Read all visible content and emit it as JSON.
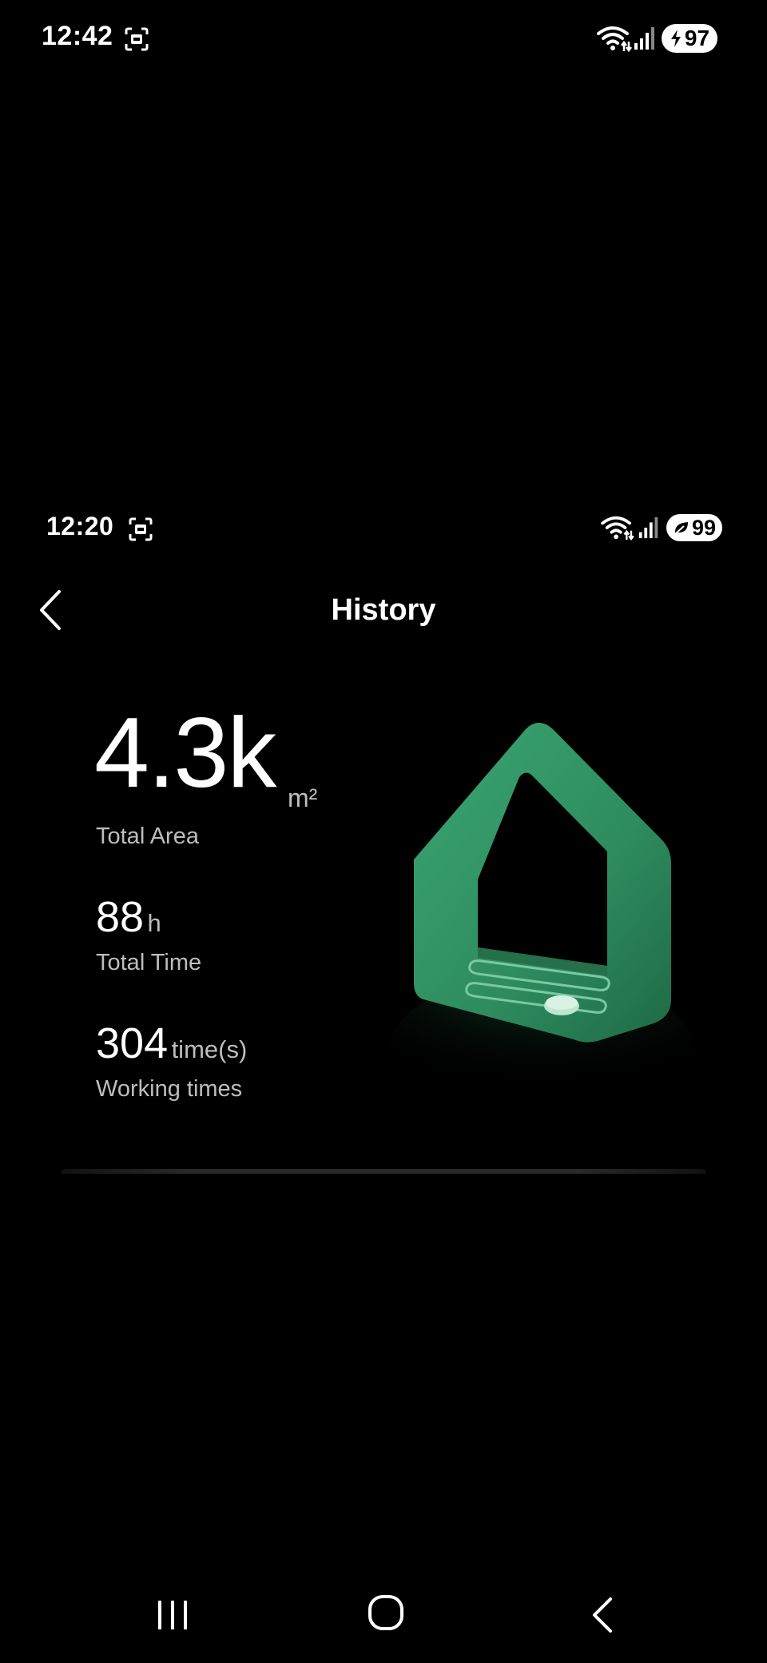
{
  "status_bar_top": {
    "time": "12:42",
    "battery": "97",
    "icons": [
      "screenshot-icon",
      "wifi-icon",
      "signal-icon",
      "charging-bolt-icon"
    ]
  },
  "status_bar_app": {
    "time": "12:20",
    "battery": "99",
    "icons": [
      "screenshot-icon",
      "wifi-icon",
      "signal-icon",
      "battery-saver-leaf-icon"
    ]
  },
  "header": {
    "title": "History",
    "back_icon": "chevron-left-icon"
  },
  "stats": {
    "total_area": {
      "value": "4.3k",
      "unit": "m²",
      "label": "Total Area"
    },
    "total_time": {
      "value": "88",
      "unit": "h",
      "label": "Total Time"
    },
    "working_times": {
      "value": "304",
      "unit": "time(s)",
      "label": "Working times"
    }
  },
  "illustration": {
    "name": "green-house-illustration",
    "color": "#2e8b5e"
  },
  "nav_bar": {
    "icons": [
      "recent-apps-icon",
      "home-icon",
      "back-icon"
    ]
  }
}
